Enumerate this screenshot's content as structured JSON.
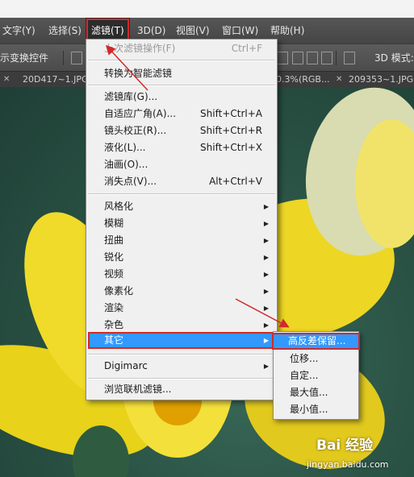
{
  "menubar": {
    "items": [
      "文字(Y)",
      "选择(S)",
      "滤镜(T)",
      "3D(D)",
      "视图(V)",
      "窗口(W)",
      "帮助(H)"
    ]
  },
  "options": {
    "label": "示变换控件",
    "mode_label": "3D 模式:"
  },
  "tabs": [
    {
      "label": "20D417~1.JPG"
    },
    {
      "label": "0.3%(RGB..."
    },
    {
      "label": "209353~1.JPG"
    }
  ],
  "filter_menu": {
    "last_filter": {
      "label": "上次滤镜操作(F)",
      "shortcut": "Ctrl+F"
    },
    "convert_smart": "转换为智能滤镜",
    "gallery": "滤镜库(G)...",
    "adaptive_wide": {
      "label": "自适应广角(A)...",
      "shortcut": "Shift+Ctrl+A"
    },
    "lens_correction": {
      "label": "镜头校正(R)...",
      "shortcut": "Shift+Ctrl+R"
    },
    "liquify": {
      "label": "液化(L)...",
      "shortcut": "Shift+Ctrl+X"
    },
    "oil_paint": "油画(O)...",
    "vanishing_point": {
      "label": "消失点(V)...",
      "shortcut": "Alt+Ctrl+V"
    },
    "stylize": "风格化",
    "blur": "模糊",
    "distort": "扭曲",
    "sharpen": "锐化",
    "video": "视频",
    "pixelate": "像素化",
    "render": "渲染",
    "noise": "杂色",
    "other": "其它",
    "digimarc": "Digimarc",
    "browse_online": "浏览联机滤镜..."
  },
  "other_submenu": {
    "high_pass": "高反差保留...",
    "offset": "位移...",
    "custom": "自定...",
    "maximum": "最大值...",
    "minimum": "最小值..."
  },
  "watermark": {
    "logo_text": "Bai 经验",
    "url": "jingyan.baidu.com"
  },
  "colors": {
    "highlight": "#3399ff",
    "annotation_red": "#d12a2a"
  }
}
